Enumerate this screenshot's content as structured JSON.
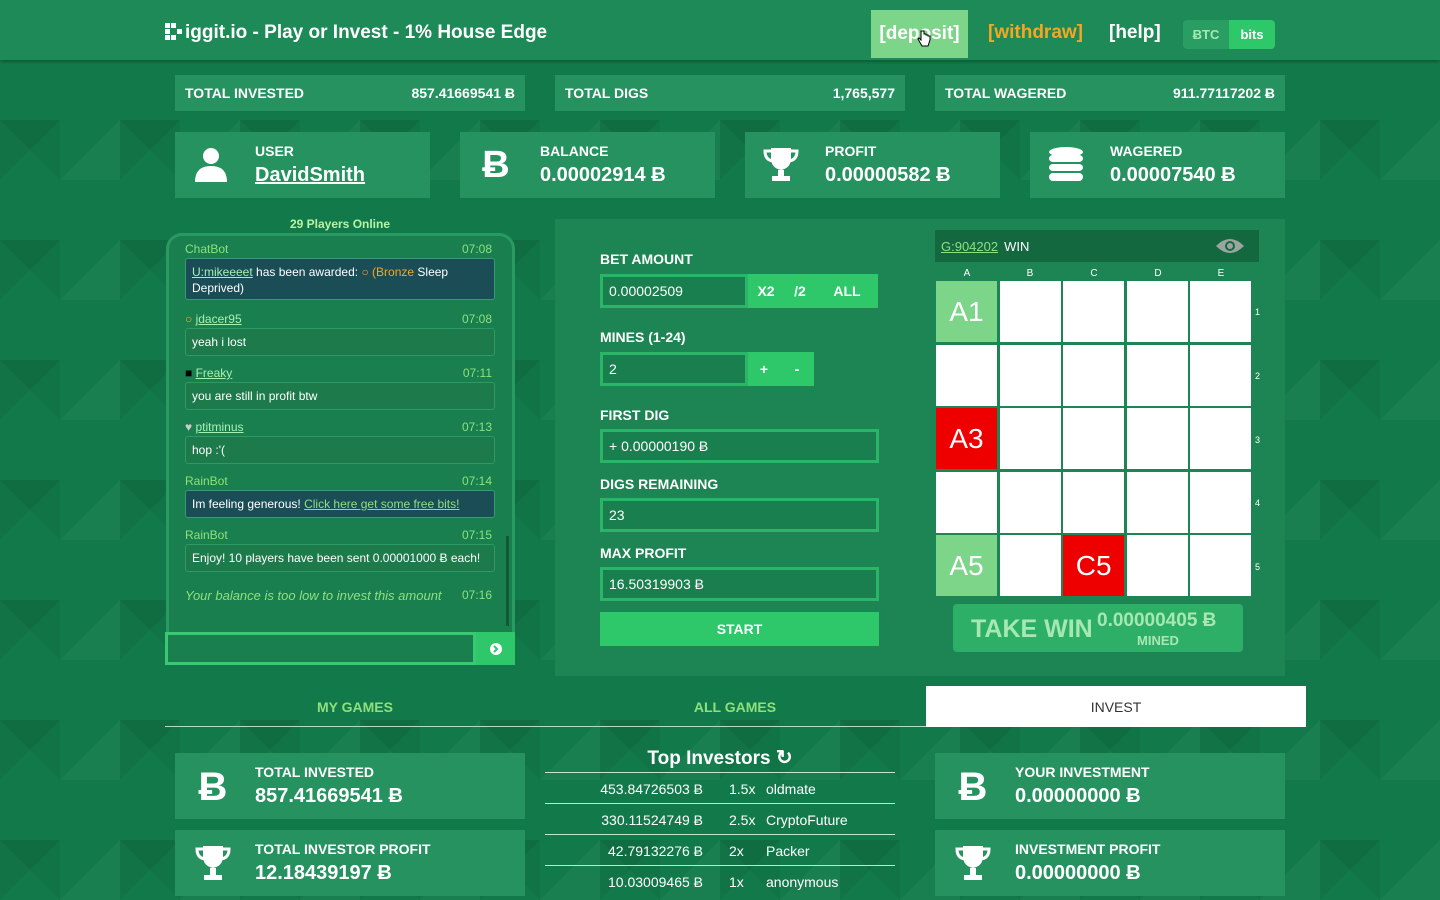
{
  "header": {
    "title": "iggit.io - Play or Invest - 1% House Edge",
    "deposit": "[deposit]",
    "withdraw": "[withdraw]",
    "help": "[help]",
    "unit_btc": "ɃTC",
    "unit_bits": "bits"
  },
  "stats": {
    "total_invested_label": "TOTAL INVESTED",
    "total_invested_value": "857.41669541 Ƀ",
    "total_digs_label": "TOTAL DIGS",
    "total_digs_value": "1,765,577",
    "total_wagered_label": "TOTAL WAGERED",
    "total_wagered_value": "911.77117202 Ƀ"
  },
  "user_cards": {
    "user_label": "USER",
    "user_value": "DavidSmith",
    "balance_label": "BALANCE",
    "balance_value": "0.00002914 Ƀ",
    "profit_label": "PROFIT",
    "profit_value": "0.00000582 Ƀ",
    "wagered_label": "WAGERED",
    "wagered_value": "0.00007540 Ƀ"
  },
  "chat": {
    "online": "29 Players Online",
    "messages": [
      {
        "name": "ChatBot",
        "time": "07:08",
        "link": "U:mikeeeet",
        "text": " has been awarded: ",
        "badge": "Bronze",
        "text2": " Sleep Deprived)"
      },
      {
        "name": "jdacer95",
        "time": "07:08",
        "text": "yeah i lost"
      },
      {
        "name": "Freaky",
        "time": "07:11",
        "text": "you are still in profit btw"
      },
      {
        "name": "ptitminus",
        "time": "07:13",
        "text": "hop :'("
      },
      {
        "name": "RainBot",
        "time": "07:14",
        "text": "Im feeling generous! ",
        "link": "Click here get some free bits!"
      },
      {
        "name": "RainBot",
        "time": "07:15",
        "text": "Enjoy! 10 players have been sent 0.00001000 Ƀ each!"
      },
      {
        "name": "",
        "time": "07:16",
        "text": "Your balance is too low to invest this amount"
      }
    ],
    "input_placeholder": ""
  },
  "game": {
    "bet_label": "BET AMOUNT",
    "bet_value": "0.00002509",
    "x2": "X2",
    "half": "/2",
    "all": "ALL",
    "mines_label": "MINES (1-24)",
    "mines_value": "2",
    "plus": "+",
    "minus": "-",
    "first_dig_label": "FIRST DIG",
    "first_dig_value": "+ 0.00000190 Ƀ",
    "digs_remaining_label": "DIGS REMAINING",
    "digs_remaining_value": "23",
    "max_profit_label": "MAX PROFIT",
    "max_profit_value": "16.50319903 Ƀ",
    "start": "START",
    "game_id": "G:904202",
    "game_result": "WIN",
    "columns": [
      "A",
      "B",
      "C",
      "D",
      "E"
    ],
    "rows": [
      "1",
      "2",
      "3",
      "4",
      "5"
    ],
    "cells": [
      {
        "label": "A1",
        "state": "safe"
      },
      {
        "label": "A3",
        "state": "mine"
      },
      {
        "label": "A5",
        "state": "safe"
      },
      {
        "label": "C5",
        "state": "mine"
      }
    ],
    "take_win": "TAKE WIN",
    "take_amount": "0.00000405 Ƀ",
    "mined": "MINED"
  },
  "tabs": {
    "my_games": "MY GAMES",
    "all_games": "ALL GAMES",
    "invest": "INVEST"
  },
  "invest": {
    "total_invested_label": "TOTAL INVESTED",
    "total_invested_value": "857.41669541 Ƀ",
    "total_investor_profit_label": "TOTAL INVESTOR PROFIT",
    "total_investor_profit_value": "12.18439197 Ƀ",
    "your_investment_label": "YOUR INVESTMENT",
    "your_investment_value": "0.00000000 Ƀ",
    "investment_profit_label": "INVESTMENT PROFIT",
    "investment_profit_value": "0.00000000 Ƀ",
    "top_title": "Top Investors",
    "top_investors": [
      {
        "amount": "453.84726503 Ƀ",
        "mult": "1.5x",
        "name": "oldmate"
      },
      {
        "amount": "330.11524749 Ƀ",
        "mult": "2.5x",
        "name": "CryptoFuture"
      },
      {
        "amount": "42.79132276 Ƀ",
        "mult": "2x",
        "name": "Packer"
      },
      {
        "amount": "10.03009465 Ƀ",
        "mult": "1x",
        "name": "anonymous"
      }
    ]
  },
  "colors": {
    "accent": "#2ec76a",
    "mine": "#ee0000",
    "safe": "#7dd58a",
    "orange": "#f5a623"
  }
}
